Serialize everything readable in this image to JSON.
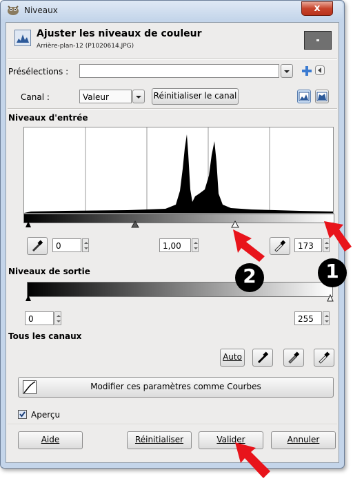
{
  "window": {
    "title": "Niveaux",
    "close_label": "x",
    "header_title": "Ajuster les niveaux de couleur",
    "header_subtitle": "Arrière-plan-12 (P1020614.JPG)"
  },
  "presets": {
    "label": "Présélections :",
    "value": ""
  },
  "channel": {
    "label": "Canal :",
    "value": "Valeur",
    "reset_label": "Réinitialiser le canal"
  },
  "input_levels": {
    "section_label": "Niveaux d'entrée",
    "low_value": "0",
    "gamma_value": "1,00",
    "high_value": "173"
  },
  "output_levels": {
    "section_label": "Niveaux de sortie",
    "low_value": "0",
    "high_value": "255"
  },
  "all_channels": {
    "section_label": "Tous les canaux",
    "auto_label": "Auto"
  },
  "curves_button_label": "Modifier ces paramètres comme Courbes",
  "preview": {
    "label": "Aperçu",
    "checked": true
  },
  "buttons": {
    "help": "Aide",
    "reset": "Réinitialiser",
    "ok": "Valider",
    "cancel": "Annuler"
  },
  "annotations": {
    "marker_1": "1",
    "marker_2": "2",
    "arrow_color": "#e8141b"
  },
  "colors": {
    "window_frame": "#c4d5ea",
    "client_bg": "#edeceb",
    "close_button": "#c7432b"
  }
}
